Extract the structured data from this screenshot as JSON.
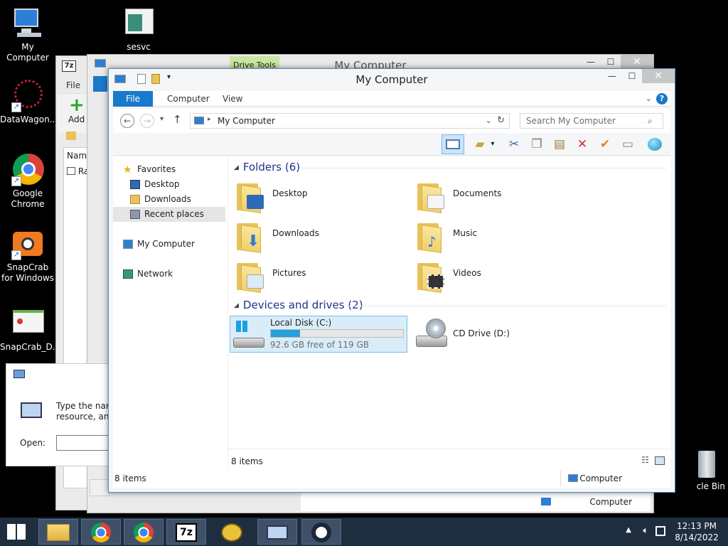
{
  "desktop": {
    "icons": [
      {
        "label": "My Computer"
      },
      {
        "label": "sesvc"
      },
      {
        "label": "DataWagon..."
      },
      {
        "label": "Google Chrome"
      },
      {
        "label": "SnapCrab for Windows"
      },
      {
        "label": "SnapCrab_D..."
      },
      {
        "label": "cle Bin"
      }
    ]
  },
  "back_window_7z": {
    "app_icon": "7z",
    "menu_file": "File",
    "add_label": "Add",
    "col_name": "Nam",
    "row_item": "Ra"
  },
  "back_window_explorer": {
    "title": "My Computer",
    "drive_tools": "Drive Tools",
    "status_location": "Computer"
  },
  "main_window": {
    "title": "My Computer",
    "tabs": {
      "file": "File",
      "computer": "Computer",
      "view": "View"
    },
    "address": {
      "path": "My Computer"
    },
    "search": {
      "placeholder": "Search My Computer"
    },
    "nav": {
      "favorites": "Favorites",
      "desktop": "Desktop",
      "downloads": "Downloads",
      "recent": "Recent places",
      "my_computer": "My Computer",
      "network": "Network"
    },
    "groups": {
      "folders": "Folders (6)",
      "devices": "Devices and drives (2)"
    },
    "folders": [
      {
        "name": "Desktop"
      },
      {
        "name": "Documents"
      },
      {
        "name": "Downloads"
      },
      {
        "name": "Music"
      },
      {
        "name": "Pictures"
      },
      {
        "name": "Videos"
      }
    ],
    "drives": [
      {
        "name": "Local Disk (C:)",
        "free": "92.6 GB free of 119 GB",
        "used_fraction": 0.22
      },
      {
        "name": "CD Drive (D:)"
      }
    ],
    "status": {
      "items": "8 items",
      "location": "Computer"
    },
    "inner_status_items": "8 items"
  },
  "run_dialog": {
    "line1": "Type the nam",
    "line2": "resource, and",
    "open_label": "Open:"
  },
  "taskbar": {
    "tasks": [
      "file-explorer",
      "chrome",
      "chrome",
      "7zip",
      "snapcrab",
      "run",
      "steam"
    ],
    "time": "12:13 PM",
    "date": "8/14/2022"
  }
}
